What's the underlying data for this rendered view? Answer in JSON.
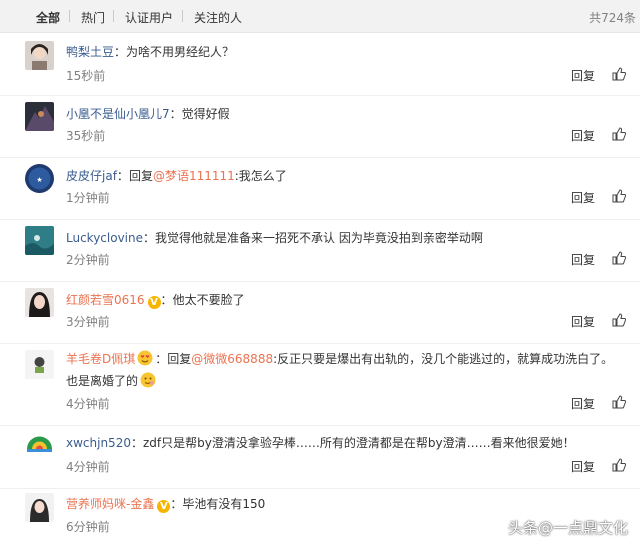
{
  "tabs": {
    "all": "全部",
    "hot": "热门",
    "verified": "认证用户",
    "following": "关注的人"
  },
  "total": "共724条",
  "reply_label": "回复",
  "comments": [
    {
      "user": "鸭梨土豆",
      "colon": "：",
      "text": "为啥不用男经纪人？",
      "time": "15秒前"
    },
    {
      "user": "小凰不是仙小凰儿7",
      "colon": "：",
      "text": "觉得好假",
      "time": "35秒前"
    },
    {
      "user": "皮皮仔jaf",
      "colon": "：",
      "prefix": "回复",
      "mention": "@梦语111111",
      "text": ":我怎么了",
      "time": "1分钟前"
    },
    {
      "user": "Luckyclovine",
      "colon": "：",
      "text": "我觉得他就是准备来一招死不承认 因为毕竟没拍到亲密举动啊",
      "time": "2分钟前"
    },
    {
      "user": "红颜若雪0616",
      "colon": "：",
      "text": "他太不要脸了",
      "time": "3分钟前"
    },
    {
      "user": "羊毛卷D佩琪",
      "colon": "：",
      "prefix": "回复",
      "mention": "@微微668888",
      "text": ":反正只要是爆出有出轨的，没几个能逃过的，就算成功洗白了。也是离婚了的",
      "time": "4分钟前"
    },
    {
      "user": "xwchjn520",
      "colon": "：",
      "text": "zdf只是帮by澄清没拿验孕棒……所有的澄清都是在帮by澄清……看来他很爱她！",
      "time": "4分钟前"
    },
    {
      "user": "营养师妈咪-金鑫",
      "colon": "：",
      "text": "毕池有没有150",
      "time": "6分钟前"
    }
  ],
  "watermark": {
    "brand": "头条",
    "sep": "@",
    "account": "一点鼎文化"
  }
}
